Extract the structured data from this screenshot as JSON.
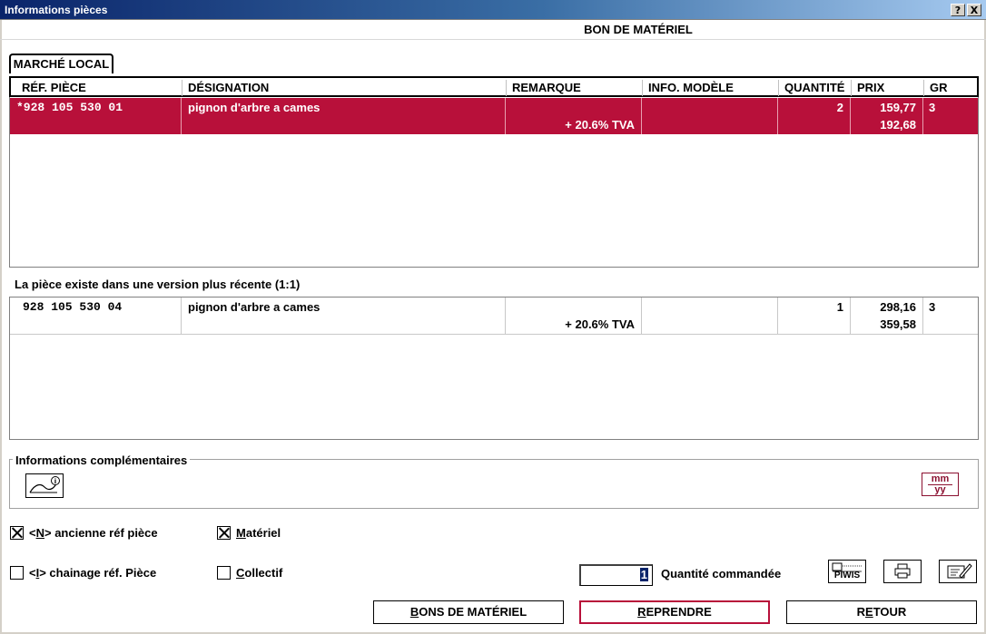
{
  "window": {
    "title": "Informations pièces",
    "help_label": "?",
    "close_label": "X"
  },
  "header": {
    "title": "BON DE MATÉRIEL"
  },
  "tab": {
    "label": "MARCHÉ LOCAL"
  },
  "table": {
    "columns": [
      "RÉF. PIÈCE",
      "DÉSIGNATION",
      "REMARQUE",
      "INFO. MODÈLE",
      "QUANTITÉ",
      "PRIX",
      "GR"
    ],
    "rows": [
      {
        "ref": "*928 105 530 01",
        "designation": "pignon d'arbre a cames",
        "remark": "+ 20.6% TVA",
        "info_model": "",
        "quantity": "2",
        "price": "159,77",
        "price_tva": "192,68",
        "gr": "3"
      }
    ]
  },
  "newer_version": {
    "label": "La pièce existe dans une version plus récente (1:1)",
    "rows": [
      {
        "ref": "928 105 530 04",
        "designation": "pignon d'arbre a cames",
        "remark": "+ 20.6% TVA",
        "info_model": "",
        "quantity": "1",
        "price": "298,16",
        "price_tva": "359,58",
        "gr": "3"
      }
    ]
  },
  "complementary": {
    "label": "Informations complémentaires",
    "date_icon_top": "mm",
    "date_icon_bottom": "yy"
  },
  "options": {
    "old_ref": {
      "label_key": "N",
      "label_prefix": "<",
      "label_suffix": "> ancienne réf pièce",
      "checked": true
    },
    "chain_ref": {
      "label_key": "I",
      "label_prefix": "<",
      "label_suffix": "> chainage réf. Pièce",
      "checked": false
    },
    "materiel": {
      "label_key": "M",
      "label_rest": "atériel",
      "checked": true
    },
    "collectif": {
      "label_key": "C",
      "label_rest": "ollectif",
      "checked": false
    }
  },
  "order": {
    "quantity_value": "1",
    "quantity_label": "Quantité commandée",
    "piwis_label": "PIWIS"
  },
  "buttons": {
    "bons_pre": "B",
    "bons_rest": "ONS DE MATÉRIEL",
    "reprendre_pre": "R",
    "reprendre_rest": "EPRENDRE",
    "retour_pre": "R",
    "retour_key": "E",
    "retour_rest": "TOUR"
  },
  "colors": {
    "selection": "#b8103a",
    "accent_border": "#b8103a",
    "date_icon": "#8b1030"
  }
}
